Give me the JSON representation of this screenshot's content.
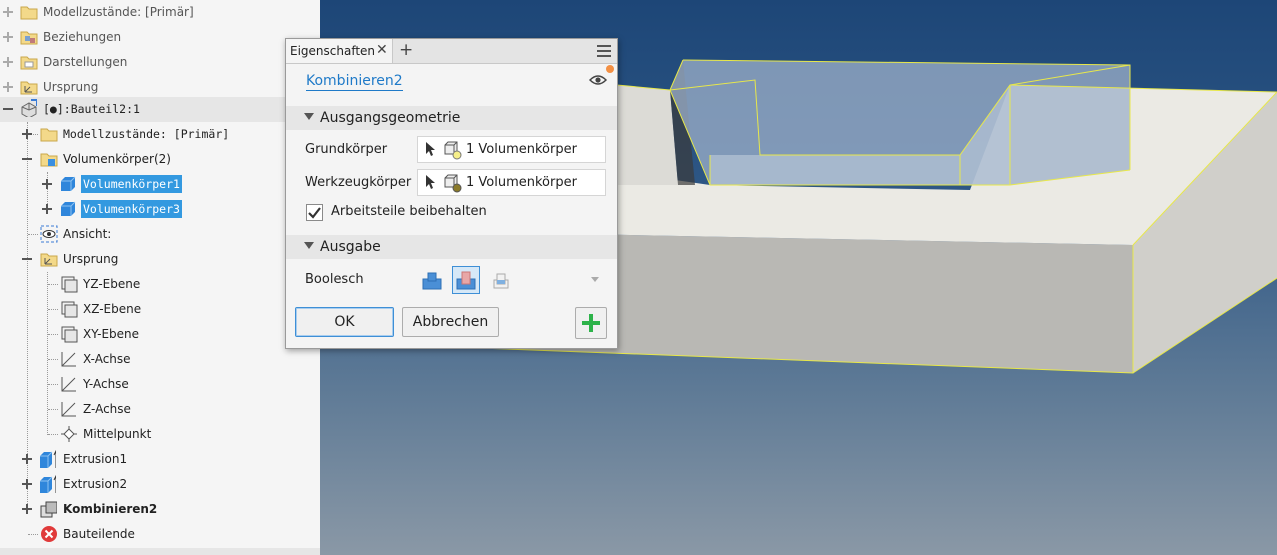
{
  "tree": {
    "rows": [
      {
        "label": "Modellzustände: [Primär]",
        "style": "dim"
      },
      {
        "label": "Beziehungen",
        "style": "dim"
      },
      {
        "label": "Darstellungen",
        "style": "dim"
      },
      {
        "label": "Ursprung",
        "style": "dim"
      },
      {
        "label": "[●]:Bauteil2:1",
        "style": "mono"
      },
      {
        "label": "Modellzustände: [Primär]",
        "style": "mono"
      },
      {
        "label": "Volumenkörper(2)",
        "style": "normal"
      },
      {
        "label": "Volumenkörper1",
        "style": "selected"
      },
      {
        "label": "Volumenkörper3",
        "style": "selected"
      },
      {
        "label": "Ansicht:",
        "style": "normal"
      },
      {
        "label": "Ursprung",
        "style": "normal"
      },
      {
        "label": "YZ-Ebene",
        "style": "normal"
      },
      {
        "label": "XZ-Ebene",
        "style": "normal"
      },
      {
        "label": "XY-Ebene",
        "style": "normal"
      },
      {
        "label": "X-Achse",
        "style": "normal"
      },
      {
        "label": "Y-Achse",
        "style": "normal"
      },
      {
        "label": "Z-Achse",
        "style": "normal"
      },
      {
        "label": "Mittelpunkt",
        "style": "normal"
      },
      {
        "label": "Extrusion1",
        "style": "normal"
      },
      {
        "label": "Extrusion2",
        "style": "normal"
      },
      {
        "label": "Kombinieren2",
        "style": "bold"
      },
      {
        "label": "Bauteilende",
        "style": "normal"
      }
    ]
  },
  "dialog": {
    "tab_label": "Eigenschaften",
    "tab_close": "✕",
    "tab_add": "+",
    "feature_name": "Kombinieren2",
    "section_input": "Ausgangsgeometrie",
    "base_label": "Grundkörper",
    "base_value": "1 Volumenkörper",
    "tool_label": "Werkzeugkörper",
    "tool_value": "1 Volumenkörper",
    "keep_tools_label": "Arbeitsteile beibehalten",
    "keep_tools_checked": true,
    "section_output": "Ausgabe",
    "boolean_label": "Boolesch",
    "boolean_selected": "Differenz",
    "ok_label": "OK",
    "cancel_label": "Abbrechen"
  },
  "colors": {
    "selection": "#3399e0",
    "link": "#1f7ac8",
    "add_green": "#2db34a",
    "notify_dot": "#f39044",
    "edge_highlight": "#e8e84a"
  }
}
